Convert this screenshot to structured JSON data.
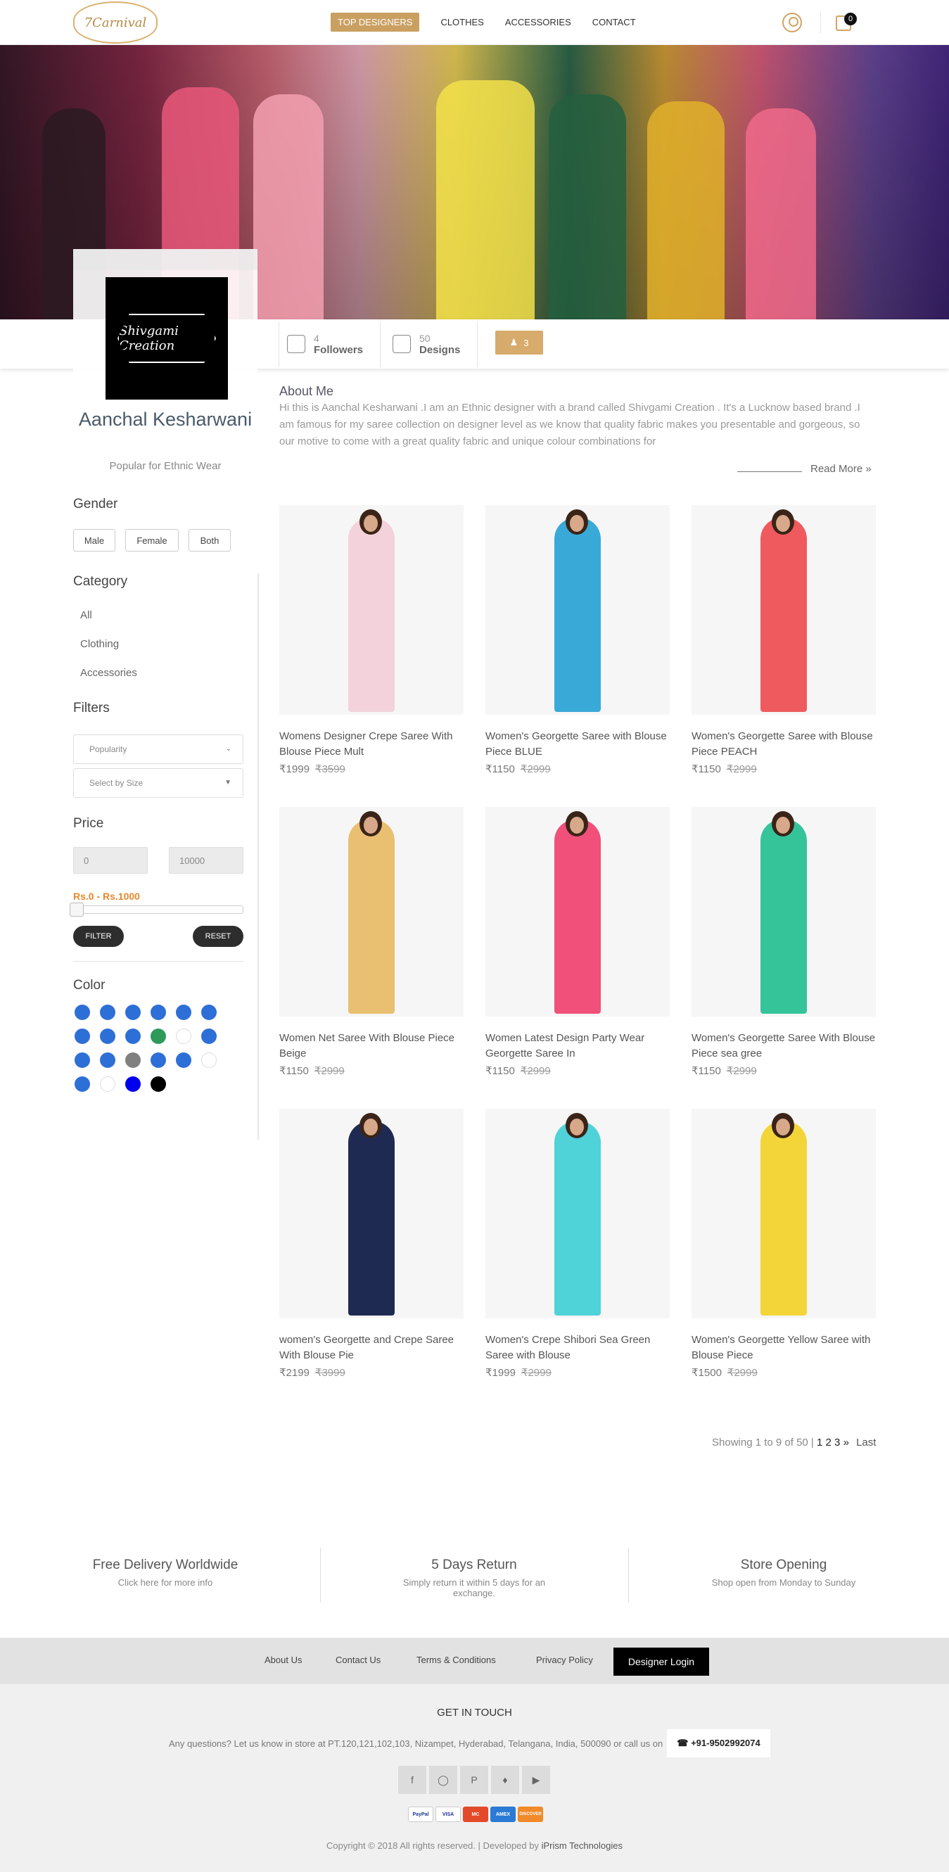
{
  "header": {
    "logo_text": "7Carnival",
    "nav": [
      "TOP DESIGNERS",
      "CLOTHES",
      "ACCESSORIES",
      "CONTACT"
    ],
    "cart_count": "0"
  },
  "profile": {
    "brand_logo_text": "Shivgami Creation",
    "name": "Aanchal Kesharwani",
    "tagline": "Popular for Ethnic Wear",
    "followers_count": "4",
    "followers_label": "Followers",
    "designs_count": "50",
    "designs_label": "Designs",
    "follow_count": "3"
  },
  "about": {
    "title": "About Me",
    "text": "Hi this is Aanchal Kesharwani .I am an Ethnic designer with a brand called Shivgami Creation . It's a Lucknow based brand .I am famous for my saree collection on designer level as we know that quality fabric makes you presentable and gorgeous, so our motive to come with a great quality fabric and unique colour combinations for",
    "read_more": "Read More"
  },
  "sidebar": {
    "gender_title": "Gender",
    "genders": [
      "Male",
      "Female",
      "Both"
    ],
    "category_title": "Category",
    "categories": [
      "All",
      "Clothing",
      "Accessories"
    ],
    "filters_title": "Filters",
    "sort_select": "Popularity",
    "size_select": "Select by Size",
    "price_title": "Price",
    "price_min": "0",
    "price_max": "10000",
    "price_range": "Rs.0 - Rs.1000",
    "filter_btn": "FILTER",
    "reset_btn": "RESET",
    "color_title": "Color",
    "colors": [
      "#2d6fd6",
      "#2d6fd6",
      "#2d6fd6",
      "#2d6fd6",
      "#2d6fd6",
      "#2d6fd6",
      "#2d6fd6",
      "#2d6fd6",
      "#2d6fd6",
      "#2e9a5a",
      "#ffffff",
      "#2d6fd6",
      "#2d6fd6",
      "#2d6fd6",
      "#808080",
      "#2d6fd6",
      "#2d6fd6",
      "#ffffff",
      "#2d6fd6",
      "#ffffff",
      "#0000ee",
      "#000000"
    ]
  },
  "products": [
    {
      "title": "Womens Designer Crepe Saree With Blouse Piece Mult",
      "price": "₹1999",
      "old_price": "₹3599",
      "color": "#f3d2dc"
    },
    {
      "title": "Women's Georgette Saree with Blouse Piece BLUE",
      "price": "₹1150",
      "old_price": "₹2999",
      "color": "#39a9d8"
    },
    {
      "title": "Women's Georgette Saree with Blouse Piece PEACH",
      "price": "₹1150",
      "old_price": "₹2999",
      "color": "#ef5a5e"
    },
    {
      "title": "Women Net Saree With Blouse Piece Beige",
      "price": "₹1150",
      "old_price": "₹2999",
      "color": "#e9bf72"
    },
    {
      "title": "Women Latest Design Party Wear Georgette Saree In",
      "price": "₹1150",
      "old_price": "₹2999",
      "color": "#f0507a"
    },
    {
      "title": "Women's Georgette Saree With Blouse Piece sea gree",
      "price": "₹1150",
      "old_price": "₹2999",
      "color": "#35c49a"
    },
    {
      "title": "women's Georgette and Crepe Saree With Blouse Pie",
      "price": "₹2199",
      "old_price": "₹3999",
      "color": "#1f2a52"
    },
    {
      "title": "Women's Crepe Shibori Sea Green Saree with Blouse",
      "price": "₹1999",
      "old_price": "₹2999",
      "color": "#4fd2d8"
    },
    {
      "title": "Women's Georgette Yellow Saree with Blouse Piece",
      "price": "₹1500",
      "old_price": "₹2999",
      "color": "#f3d53a"
    }
  ],
  "pagination": {
    "showing": "Showing 1 to 9 of 50 |",
    "pages": "1 2 3",
    "next": "»",
    "last": "Last"
  },
  "features": [
    {
      "title": "Free Delivery Worldwide",
      "sub": "Click here for more info"
    },
    {
      "title": "5 Days Return",
      "sub": "Simply return it within 5 days for an exchange."
    },
    {
      "title": "Store Opening",
      "sub": "Shop open from Monday to Sunday"
    }
  ],
  "footer": {
    "links": [
      "About Us",
      "Contact Us",
      "Terms & Conditions",
      "Privacy Policy"
    ],
    "designer_login": "Designer Login",
    "get_in_touch": "GET IN TOUCH",
    "contact_text": "Any questions? Let us know in store at PT.120,121,102,103, Nizampet, Hyderabad, Telangana, India, 500090 or call us on",
    "phone": "+91-9502992074",
    "social_icons": [
      "facebook-icon",
      "instagram-icon",
      "pinterest-icon",
      "snapchat-icon",
      "youtube-icon"
    ],
    "payments": [
      "PayPal",
      "VISA",
      "MC",
      "AMEX",
      "DISCOVER"
    ],
    "copyright": "Copyright © 2018 All rights reserved. | Developed by",
    "developer": "iPrism Technologies"
  }
}
